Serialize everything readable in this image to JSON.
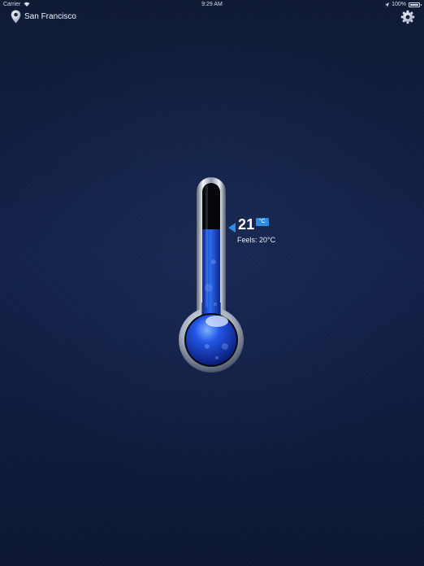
{
  "status_bar": {
    "carrier": "Carrier",
    "time": "9:29 AM",
    "battery": "100%"
  },
  "header": {
    "location": "San Francisco",
    "location_icon": "map-pin-icon",
    "settings_icon": "gear-icon"
  },
  "weather": {
    "temperature": "21",
    "unit": "°C",
    "feels_label": "Feels:",
    "feels_value": "20°C"
  },
  "colors": {
    "background": "#13214a",
    "accent": "#2f8be0",
    "mercury": "#1f52e0"
  }
}
